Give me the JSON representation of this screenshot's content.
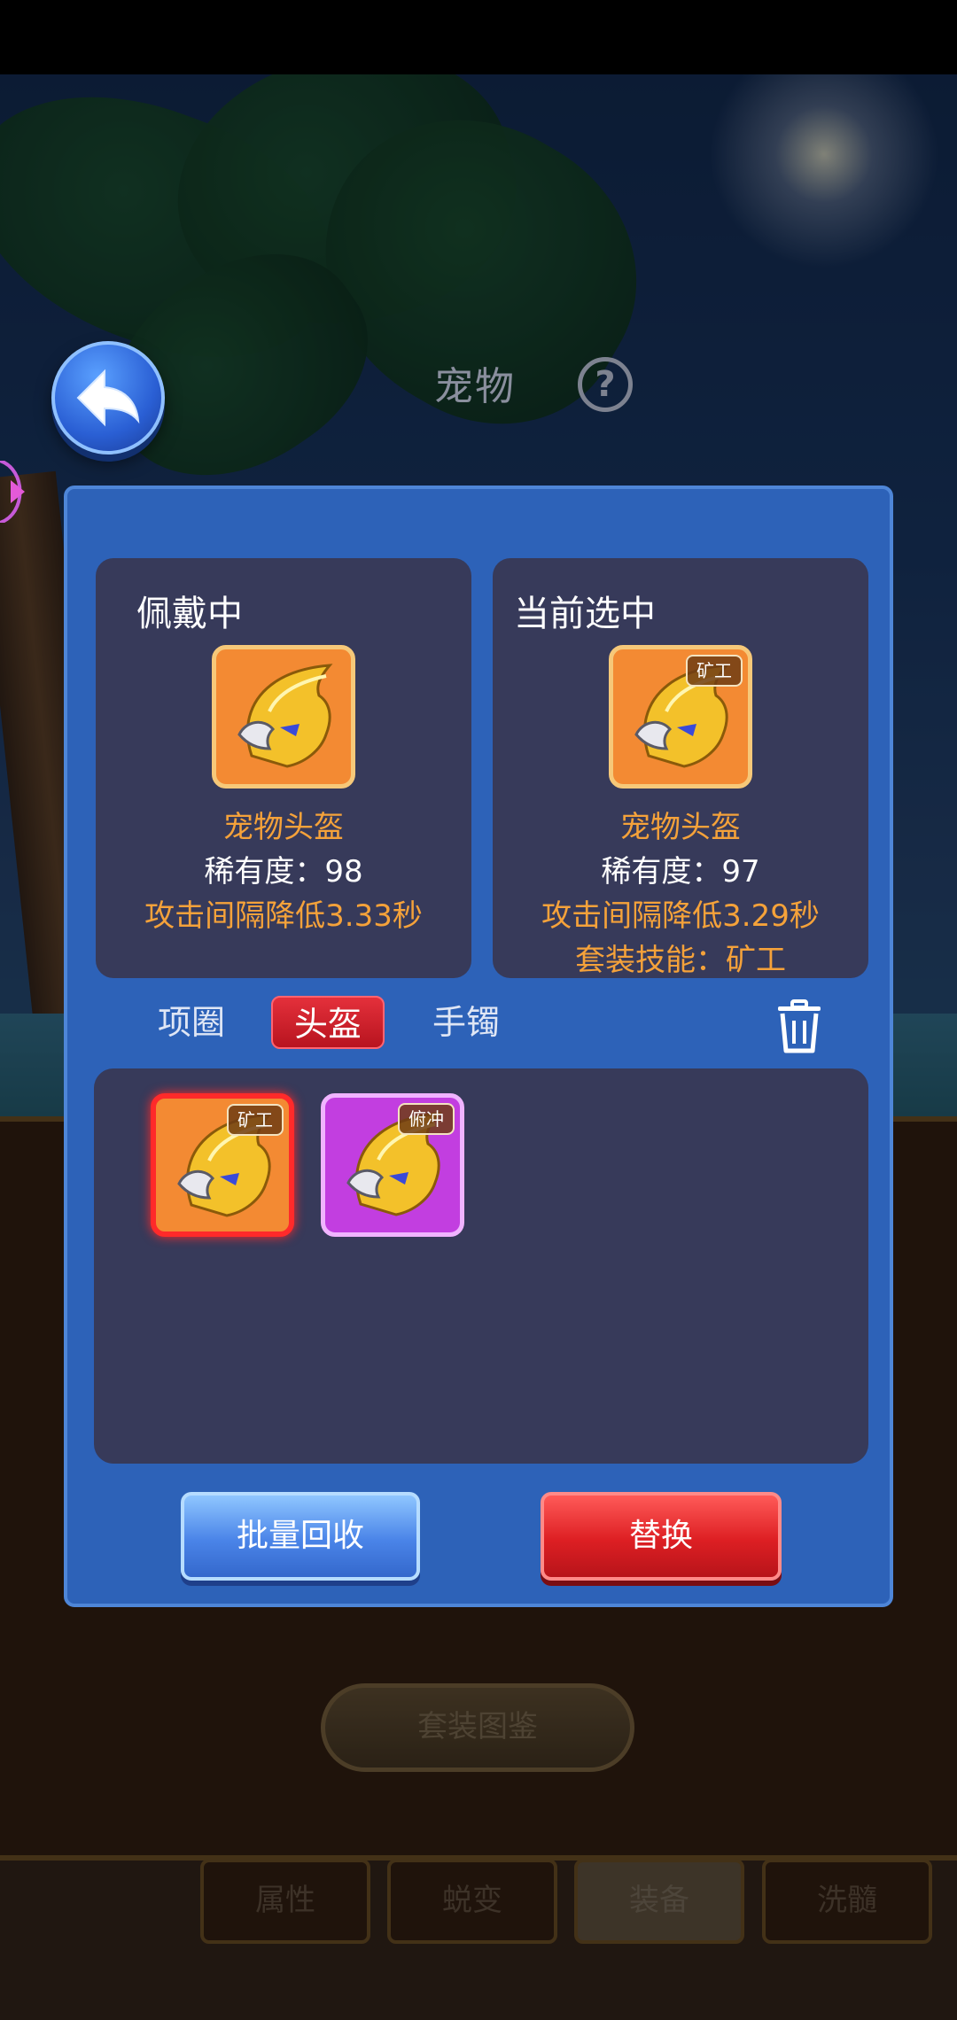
{
  "header": {
    "title": "宠物",
    "help_glyph": "?"
  },
  "current_card": {
    "heading": "佩戴中",
    "name": "宠物头盔",
    "rarity": "稀有度：98",
    "effect": "攻击间隔降低3.33秒"
  },
  "selected_card": {
    "heading": "当前选中",
    "tag": "矿工",
    "name": "宠物头盔",
    "rarity": "稀有度：97",
    "effect": "攻击间隔降低3.29秒",
    "skill": "套装技能：矿工"
  },
  "category_tabs": [
    {
      "label": "项圈"
    },
    {
      "label": "头盔"
    },
    {
      "label": "手镯"
    }
  ],
  "inventory": [
    {
      "tag": "矿工",
      "quality_color": "#f38a33"
    },
    {
      "tag": "俯冲",
      "quality_color": "#c23ee0"
    }
  ],
  "actions": {
    "recycle_label": "批量回收",
    "replace_label": "替换"
  },
  "background": {
    "suit_button": "套装图鉴",
    "tabs": [
      {
        "label": "属性"
      },
      {
        "label": "蜕变"
      },
      {
        "label": "装备"
      },
      {
        "label": "洗髓"
      }
    ]
  },
  "colors": {
    "modal_blue": "#2d62b8",
    "panel_dark": "#373a5a",
    "accent_orange": "#f5a23a",
    "active_red": "#d21f2a"
  }
}
